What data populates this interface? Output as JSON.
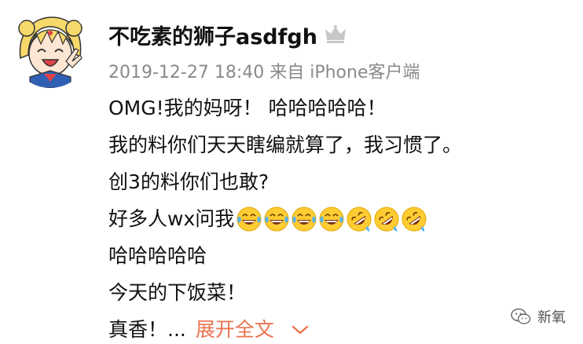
{
  "post": {
    "username": "不吃素的狮子asdfgh",
    "meta": "2019-12-27 18:40 来自 iPhone客户端",
    "lines": [
      "OMG!我的妈呀！ 哈哈哈哈哈！",
      "我的料你们天天瞎编就算了，我习惯了。",
      "创3的料你们也敢?",
      "好多人wx问我",
      "哈哈哈哈哈",
      "今天的下饭菜！",
      "真香！..."
    ],
    "expand_label": "展开全文",
    "emojis": [
      "laugh-cry-emoji",
      "laugh-cry-emoji",
      "laugh-cry-emoji",
      "laugh-cry-emoji",
      "rolling-laugh-emoji",
      "rolling-laugh-emoji",
      "rolling-laugh-emoji"
    ]
  },
  "watermark": {
    "text": "新氧"
  },
  "colors": {
    "text": "#111111",
    "meta": "#8a8a8a",
    "accent": "#eb7350"
  }
}
